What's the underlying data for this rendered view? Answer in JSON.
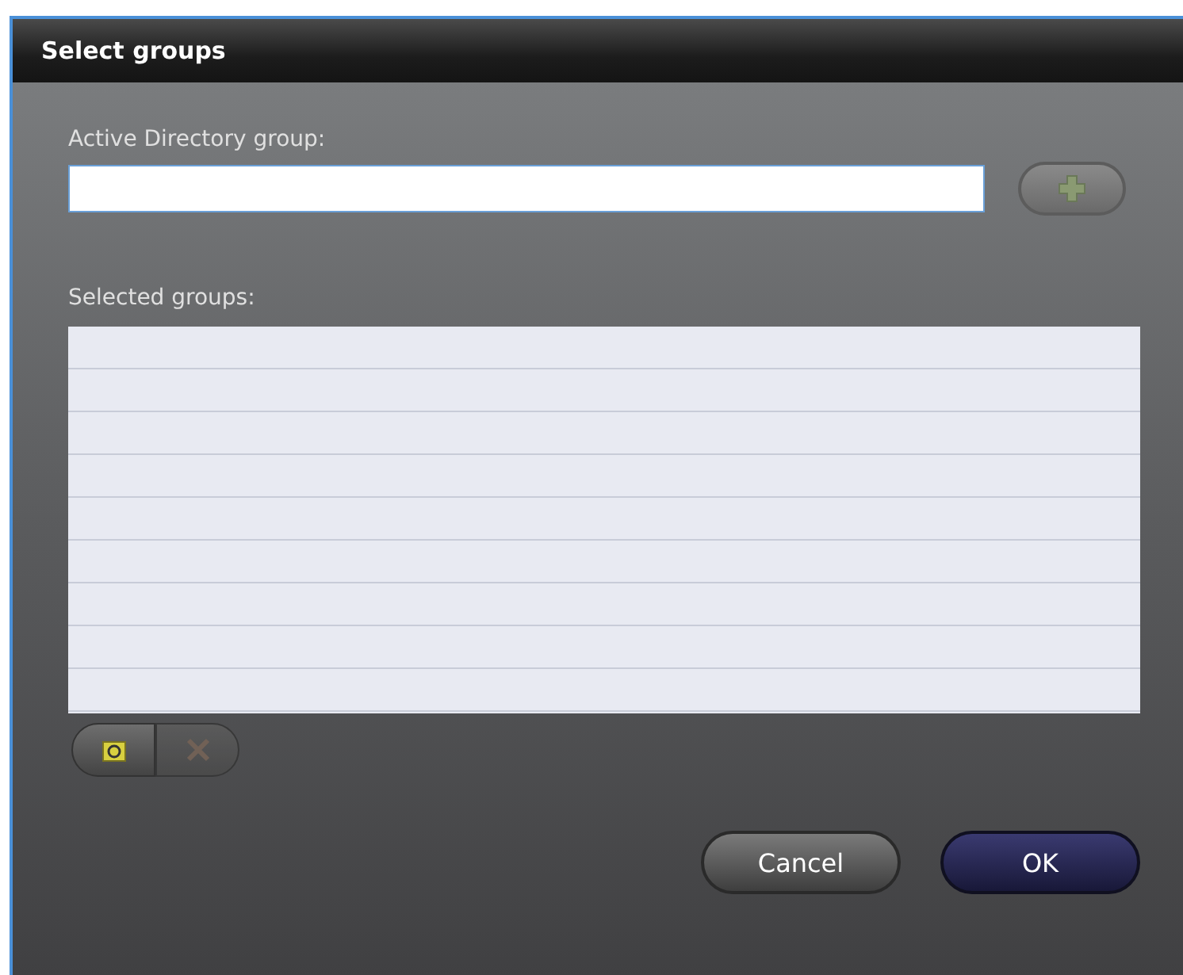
{
  "window": {
    "title": "Select groups"
  },
  "ad_group": {
    "label": "Active Directory group:",
    "add_disabled": true
  },
  "selected_groups": {
    "label": "Selected groups:",
    "delete_disabled": true
  },
  "buttons": [
    {
      "label": "Cancel",
      "kind": "secondary"
    },
    {
      "label": "OK",
      "kind": "primary"
    }
  ]
}
